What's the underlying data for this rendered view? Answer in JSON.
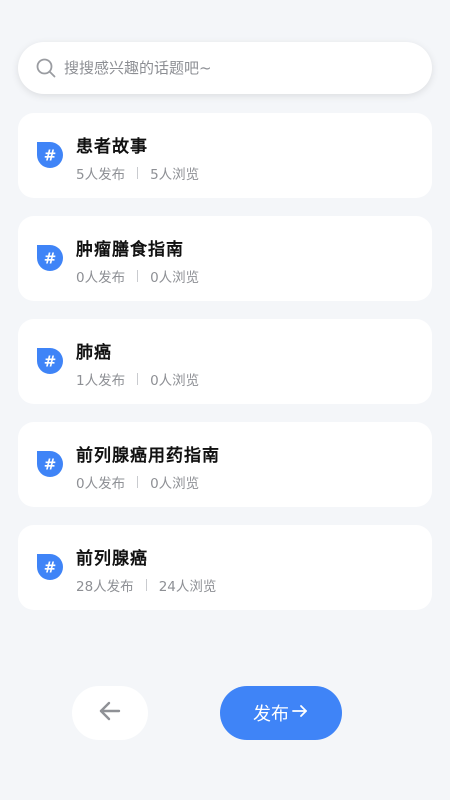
{
  "search": {
    "placeholder": "搜搜感兴趣的话题吧~"
  },
  "topics": [
    {
      "title": "患者故事",
      "publishers": "5人发布",
      "viewers": "5人浏览"
    },
    {
      "title": "肿瘤膳食指南",
      "publishers": "0人发布",
      "viewers": "0人浏览"
    },
    {
      "title": "肺癌",
      "publishers": "1人发布",
      "viewers": "0人浏览"
    },
    {
      "title": "前列腺癌用药指南",
      "publishers": "0人发布",
      "viewers": "0人浏览"
    },
    {
      "title": "前列腺癌",
      "publishers": "28人发布",
      "viewers": "24人浏览"
    }
  ],
  "footer": {
    "back_icon": "arrow-left-icon",
    "publish_label": "发布",
    "publish_icon": "arrow-right-icon"
  },
  "colors": {
    "accent": "#3f84f7",
    "background": "#f4f6f9"
  }
}
